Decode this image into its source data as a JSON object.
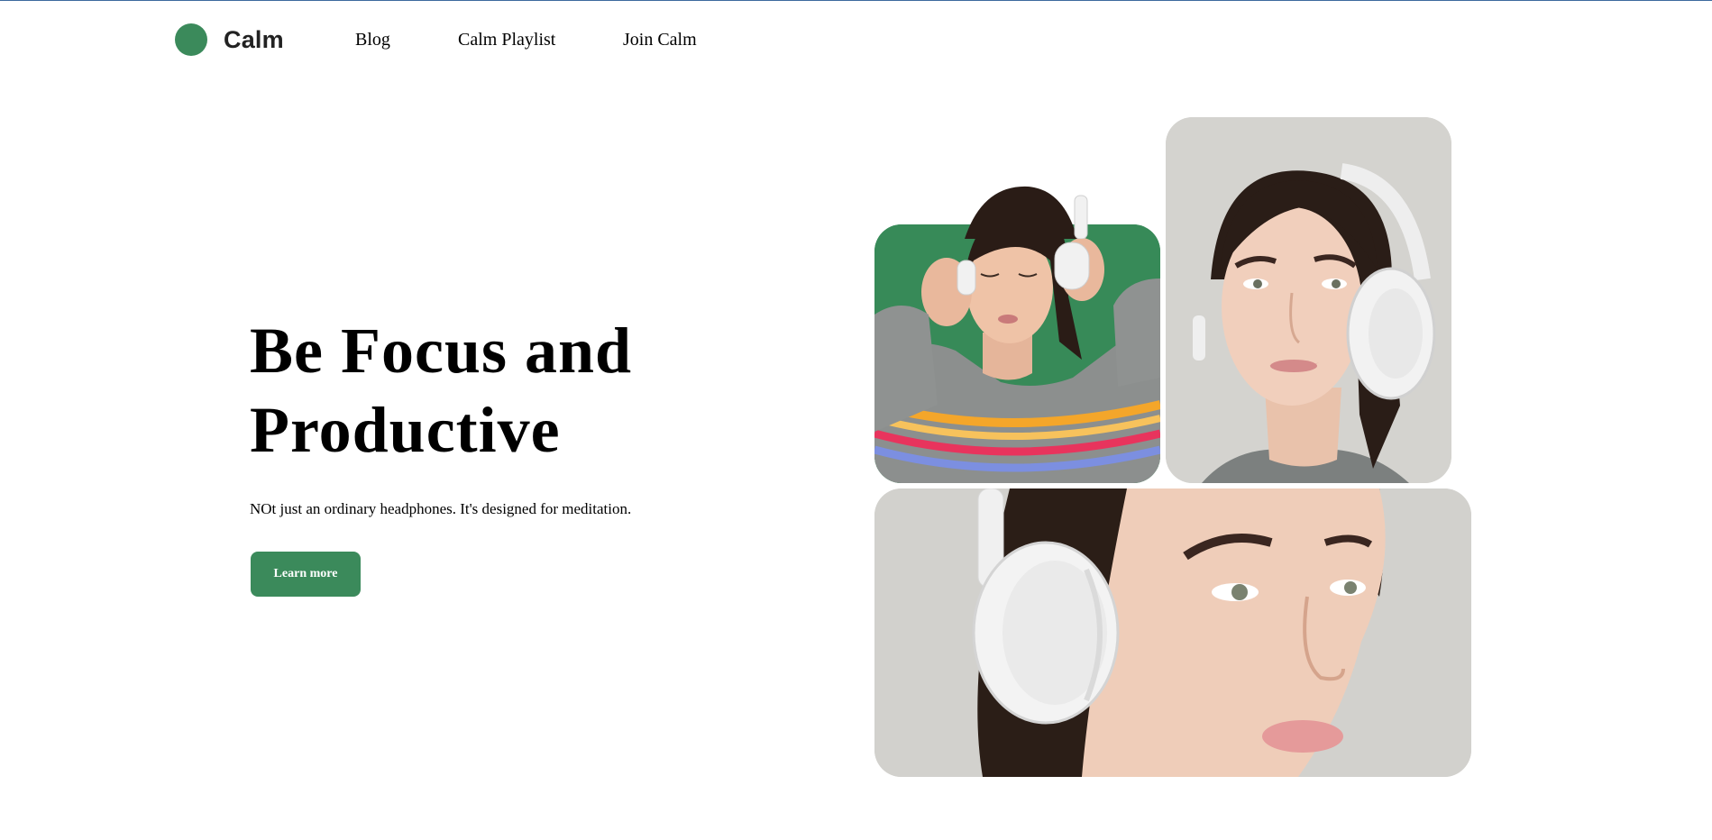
{
  "nav": {
    "brand": "Calm",
    "links": [
      "Blog",
      "Calm Playlist",
      "Join Calm"
    ]
  },
  "hero": {
    "title": "Be Focus and Productive",
    "subtitle": "NOt just an ordinary headphones. It's designed for meditation.",
    "cta_label": "Learn more"
  },
  "colors": {
    "brand_green": "#3b8a5b",
    "photo_bg_green": "#378a58",
    "photo_bg_gray": "#d4d3cf"
  },
  "images": [
    {
      "name": "woman-headphones-green-photo"
    },
    {
      "name": "woman-headphones-portrait-photo"
    },
    {
      "name": "woman-headphones-closeup-photo"
    }
  ]
}
